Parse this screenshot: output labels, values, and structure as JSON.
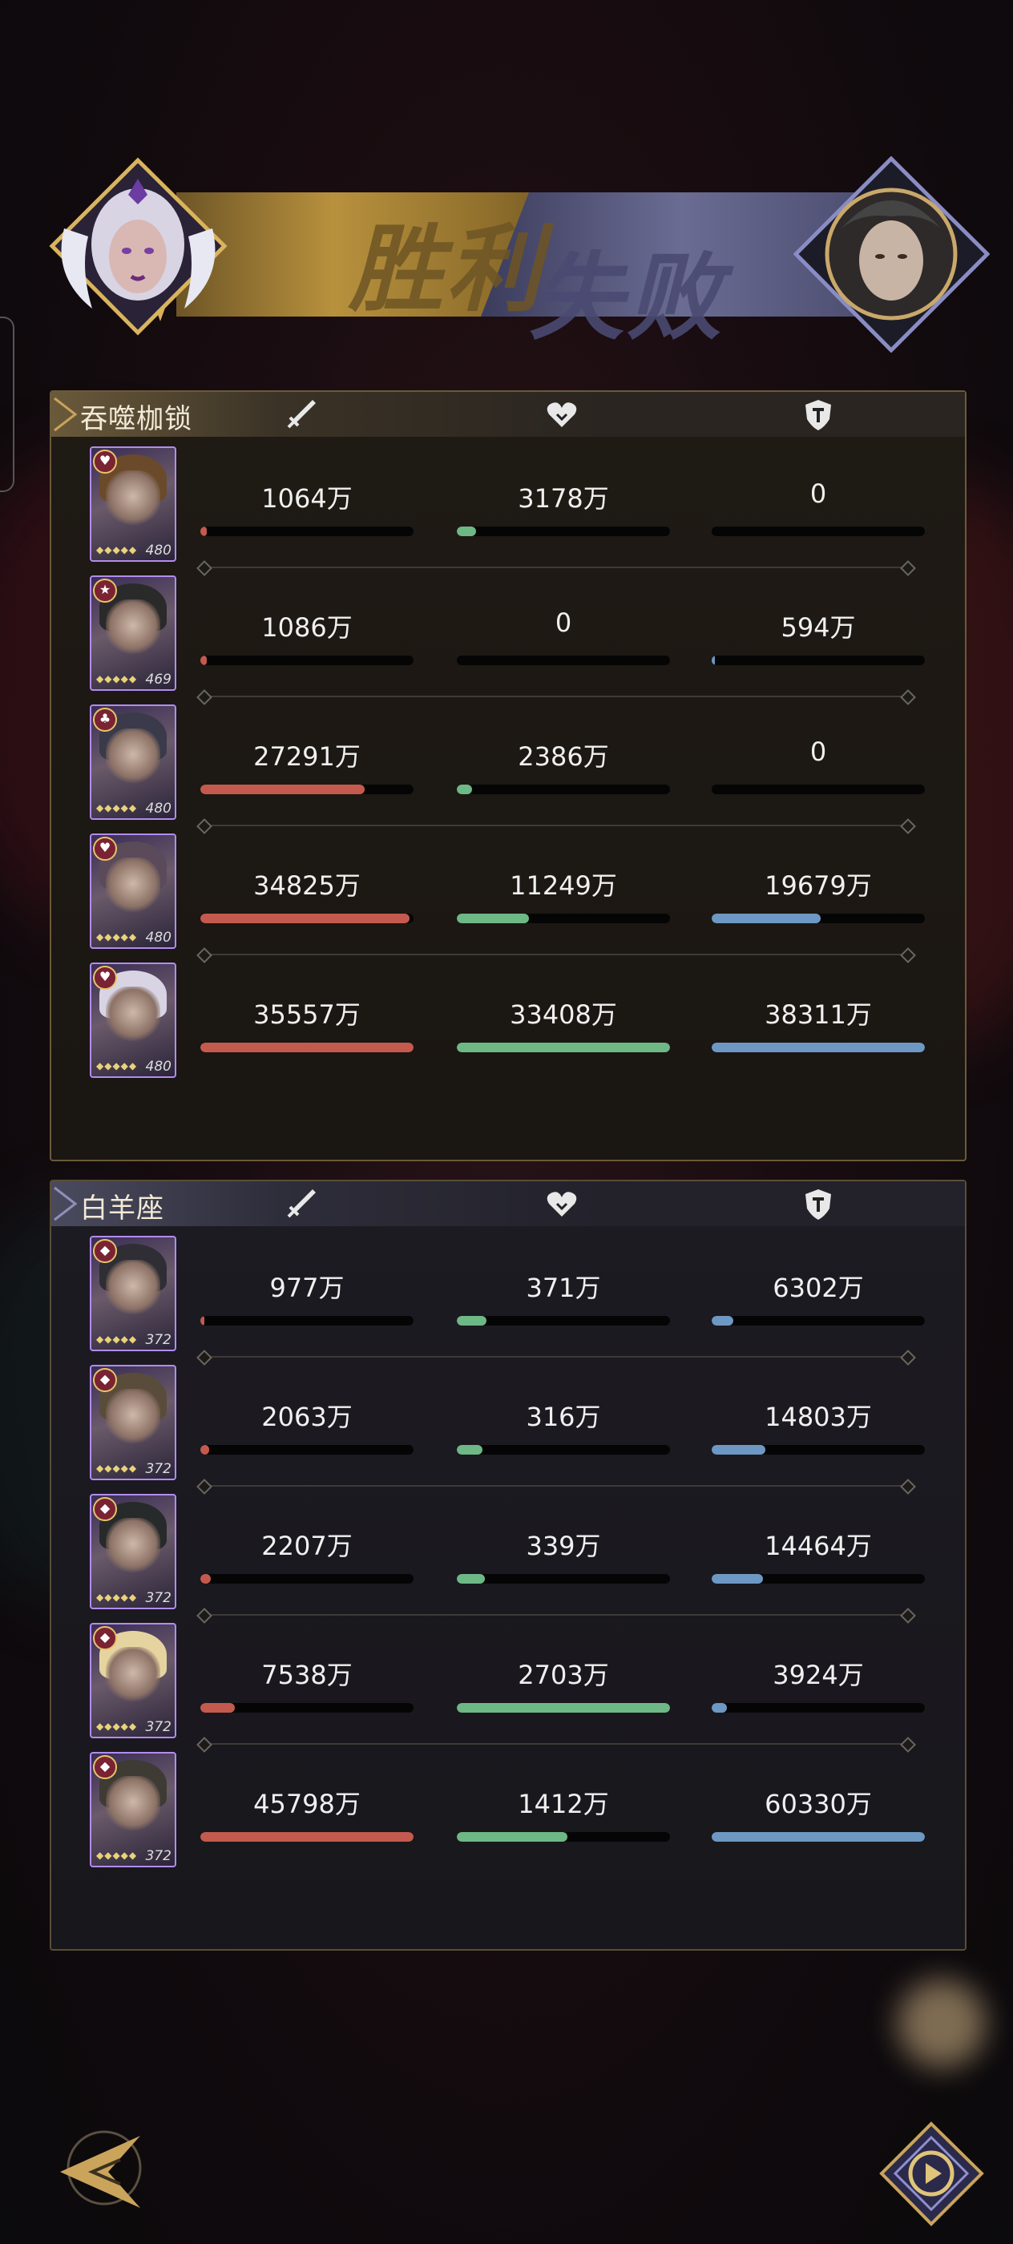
{
  "header": {
    "win_label": "胜利",
    "lose_label": "失败"
  },
  "colors": {
    "damage": "#c45a4e",
    "heal": "#6eb886",
    "shield": "#6e98c4"
  },
  "teams": [
    {
      "name": "吞噬枷锁",
      "rows": [
        {
          "level": "480",
          "badge": "♥",
          "damage": "1064万",
          "heal": "3178万",
          "shield": "0",
          "damage_pct": 3,
          "heal_pct": 9,
          "shield_pct": 0
        },
        {
          "level": "469",
          "badge": "★",
          "damage": "1086万",
          "heal": "0",
          "shield": "594万",
          "damage_pct": 3,
          "heal_pct": 0,
          "shield_pct": 1.5
        },
        {
          "level": "480",
          "badge": "♣",
          "damage": "27291万",
          "heal": "2386万",
          "shield": "0",
          "damage_pct": 77,
          "heal_pct": 7,
          "shield_pct": 0
        },
        {
          "level": "480",
          "badge": "♥",
          "damage": "34825万",
          "heal": "11249万",
          "shield": "19679万",
          "damage_pct": 98,
          "heal_pct": 34,
          "shield_pct": 51
        },
        {
          "level": "480",
          "badge": "♥",
          "damage": "35557万",
          "heal": "33408万",
          "shield": "38311万",
          "damage_pct": 100,
          "heal_pct": 100,
          "shield_pct": 100
        }
      ]
    },
    {
      "name": "白羊座",
      "rows": [
        {
          "level": "372",
          "badge": "◆",
          "damage": "977万",
          "heal": "371万",
          "shield": "6302万",
          "damage_pct": 2,
          "heal_pct": 14,
          "shield_pct": 10
        },
        {
          "level": "372",
          "badge": "◆",
          "damage": "2063万",
          "heal": "316万",
          "shield": "14803万",
          "damage_pct": 4,
          "heal_pct": 12,
          "shield_pct": 25
        },
        {
          "level": "372",
          "badge": "◆",
          "damage": "2207万",
          "heal": "339万",
          "shield": "14464万",
          "damage_pct": 5,
          "heal_pct": 13,
          "shield_pct": 24
        },
        {
          "level": "372",
          "badge": "◆",
          "damage": "7538万",
          "heal": "2703万",
          "shield": "3924万",
          "damage_pct": 16,
          "heal_pct": 100,
          "shield_pct": 7
        },
        {
          "level": "372",
          "badge": "◆",
          "damage": "45798万",
          "heal": "1412万",
          "shield": "60330万",
          "damage_pct": 100,
          "heal_pct": 52,
          "shield_pct": 100
        }
      ]
    }
  ],
  "icons": {
    "damage": "sword-icon",
    "heal": "heart-icon",
    "shield": "shield-icon",
    "back": "back-arrow-icon",
    "replay": "replay-icon"
  }
}
